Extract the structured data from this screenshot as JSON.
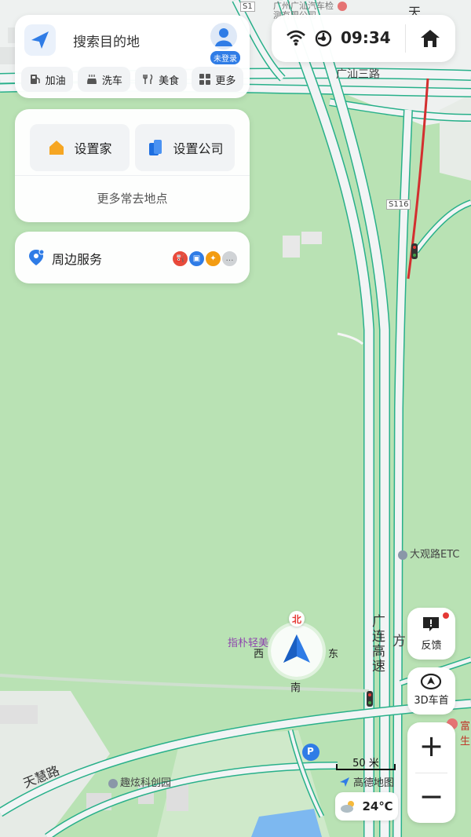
{
  "search": {
    "placeholder": "搜索目的地",
    "login_badge": "未登录",
    "quick_items": [
      {
        "label": "加油",
        "icon": "fuel-icon"
      },
      {
        "label": "洗车",
        "icon": "car-wash-icon"
      },
      {
        "label": "美食",
        "icon": "food-icon"
      },
      {
        "label": "更多",
        "icon": "grid-icon"
      }
    ]
  },
  "home": {
    "set_home": "设置家",
    "set_company": "设置公司",
    "more_places": "更多常去地点"
  },
  "nearby": {
    "label": "周边服务"
  },
  "status": {
    "time": "09:34"
  },
  "controls": {
    "feedback": "反馈",
    "view_mode": "3D车首"
  },
  "map": {
    "labels": {
      "top_poi": "广州广汕汽车检测有限公司",
      "road_s1": "S1",
      "road_top": "广汕三路",
      "road_s116": "S116",
      "etc": "大观路ETC",
      "expressway": "广连高速",
      "company": "指朴轻美",
      "park": "趣炫科创园",
      "road_tianhui": "天慧路",
      "parking": "P",
      "east_fang": "方",
      "left_edge": "富生",
      "top_right": "天"
    },
    "compass": {
      "north": "北",
      "south": "南",
      "east": "东",
      "west": "西"
    },
    "scale": "50 米",
    "brand": "高德地图",
    "temperature": "24℃"
  },
  "colors": {
    "map_green": "#b9e2b4",
    "road_fill": "#f2f4f5",
    "road_edge": "#28b08a",
    "accent_blue": "#2f7ce6",
    "red_road": "#d32f2f"
  }
}
